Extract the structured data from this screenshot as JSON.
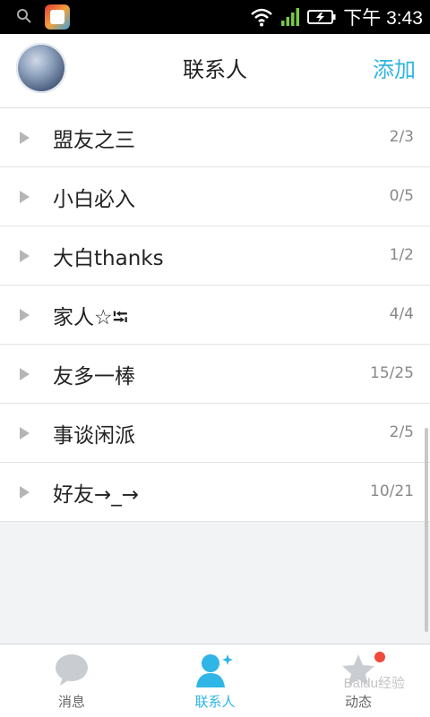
{
  "status_bar": {
    "time": "下午 3:43"
  },
  "header": {
    "title": "联系人",
    "add_label": "添加"
  },
  "groups": [
    {
      "name": "盟友之三",
      "count": "2/3"
    },
    {
      "name": "小白必入",
      "count": "0/5"
    },
    {
      "name": "大白thanks",
      "count": "1/2"
    },
    {
      "name": "家人☆⭾",
      "count": "4/4"
    },
    {
      "name": "友多一棒",
      "count": "15/25"
    },
    {
      "name": "事谈闲派",
      "count": "2/5"
    },
    {
      "name": "好友→_→",
      "count": "10/21"
    }
  ],
  "tabs": [
    {
      "label": "消息",
      "icon": "chat-bubble-icon"
    },
    {
      "label": "联系人",
      "icon": "contacts-icon",
      "active": true
    },
    {
      "label": "动态",
      "icon": "star-icon",
      "badge": true
    }
  ],
  "watermark": "Baidu经验",
  "colors": {
    "accent": "#2fb5e6",
    "badge": "#ef4a3a"
  }
}
